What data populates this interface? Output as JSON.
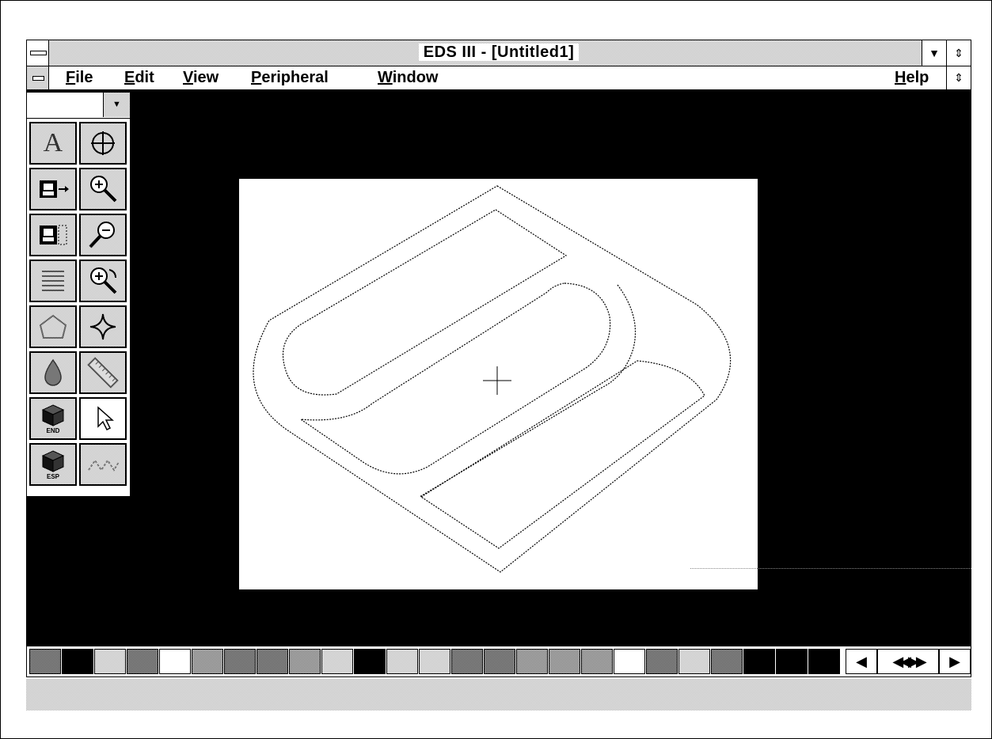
{
  "window": {
    "title": "EDS III - [Untitled1]",
    "minimize_glyph": "▼",
    "restore_glyph": "⇕"
  },
  "menu": {
    "items": [
      {
        "mnemonic": "F",
        "rest": "ile"
      },
      {
        "mnemonic": "E",
        "rest": "dit"
      },
      {
        "mnemonic": "V",
        "rest": "iew"
      },
      {
        "mnemonic": "P",
        "rest": "eripheral"
      },
      {
        "mnemonic": "W",
        "rest": "indow"
      }
    ],
    "help": {
      "mnemonic": "H",
      "rest": "elp"
    },
    "doc_restore_glyph": "⇕"
  },
  "toolbox": {
    "combo_value": "",
    "combo_arrow": "▼",
    "tools": [
      {
        "name": "text-tool",
        "icon": "letter-a-icon",
        "text": "A"
      },
      {
        "name": "crosshair-tool",
        "icon": "crosshair-circle-icon"
      },
      {
        "name": "import-tool",
        "icon": "image-arrow-icon"
      },
      {
        "name": "zoom-in-tool",
        "icon": "zoom-in-icon"
      },
      {
        "name": "image-frame-tool",
        "icon": "image-frame-icon"
      },
      {
        "name": "zoom-out-tool",
        "icon": "zoom-out-icon"
      },
      {
        "name": "fill-lines-tool",
        "icon": "hatch-lines-icon"
      },
      {
        "name": "zoom-previous-tool",
        "icon": "zoom-previous-icon"
      },
      {
        "name": "polygon-tool",
        "icon": "polygon-icon"
      },
      {
        "name": "node-tool",
        "icon": "star-node-icon"
      },
      {
        "name": "fill-tool",
        "icon": "fill-drop-icon"
      },
      {
        "name": "ruler-tool",
        "icon": "ruler-icon"
      },
      {
        "name": "end-tool",
        "icon": "cube-end-icon",
        "text": "END"
      },
      {
        "name": "select-tool",
        "icon": "arrow-pointer-icon"
      },
      {
        "name": "esp-tool",
        "icon": "cube-esp-icon",
        "text": "ESP"
      },
      {
        "name": "stitch-tool",
        "icon": "stitch-icon"
      }
    ]
  },
  "palette": {
    "swatches": [
      "dark",
      "black",
      "light",
      "dark",
      "white",
      "mid",
      "dark",
      "dark",
      "mid",
      "light",
      "black",
      "light",
      "light",
      "dark",
      "dark",
      "mid",
      "mid",
      "mid",
      "white",
      "dark",
      "light",
      "dark",
      "black",
      "black",
      "black"
    ],
    "nav": [
      "◀",
      "◀◀▶▶",
      "▶"
    ]
  }
}
